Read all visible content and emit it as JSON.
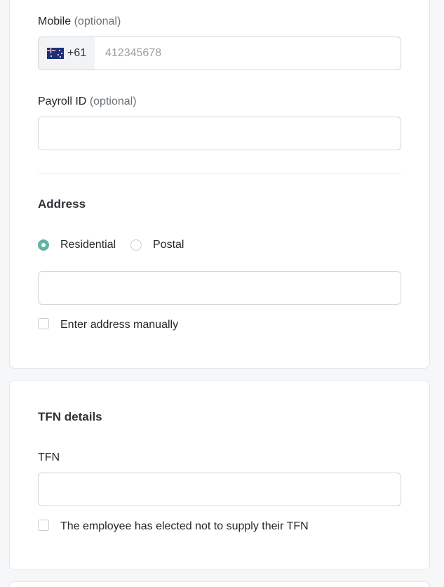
{
  "contact": {
    "mobile_label": "Mobile",
    "mobile_optional": "(optional)",
    "mobile_country_code": "+61",
    "mobile_placeholder": "412345678",
    "flag_icon": "australia-flag-icon",
    "payroll_label": "Payroll ID",
    "payroll_optional": "(optional)",
    "payroll_value": ""
  },
  "address": {
    "title": "Address",
    "options": [
      {
        "label": "Residential",
        "selected": true
      },
      {
        "label": "Postal",
        "selected": false
      }
    ],
    "value": "",
    "manual_label": "Enter address manually",
    "manual_checked": false
  },
  "tfn": {
    "title": "TFN details",
    "field_label": "TFN",
    "value": "",
    "not_supplied_label": "The employee has elected not to supply their TFN",
    "not_supplied_checked": false
  },
  "colors": {
    "accent": "#63b3a3",
    "border": "#d3d6da",
    "card_border": "#e3e5e8",
    "background": "#f6f7f8"
  }
}
